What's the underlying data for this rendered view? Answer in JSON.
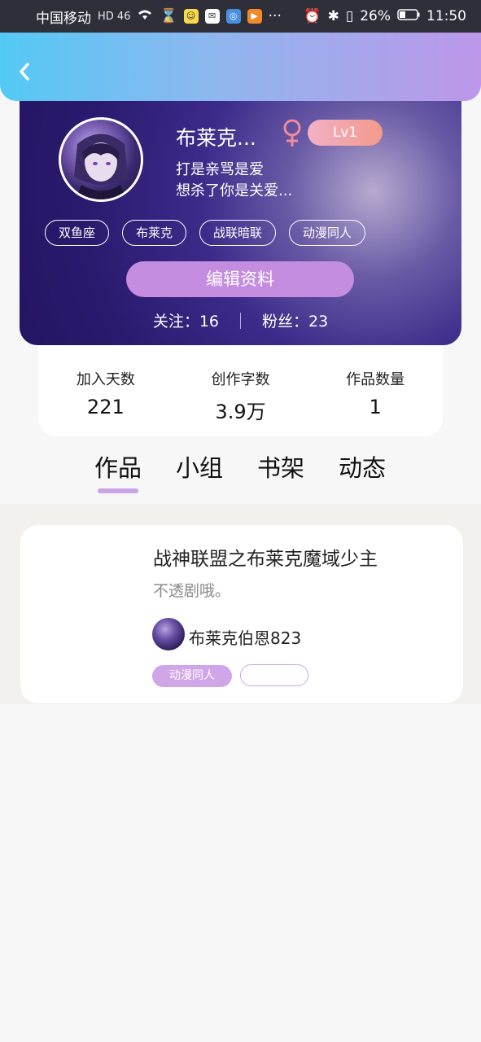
{
  "status_bar": {
    "carrier": "中国移动",
    "network": "HD 46",
    "battery": "26%",
    "time": "11:50",
    "more": "···"
  },
  "profile": {
    "username": "布莱克...",
    "gender_symbol": "♀",
    "level": "Lv1",
    "bio_line1": "打是亲骂是爱",
    "bio_line2": "想杀了你是关爱...",
    "tags": [
      "双鱼座",
      "布莱克",
      "战联暗联",
      "动漫同人"
    ],
    "edit_button": "编辑资料",
    "following": "关注：16",
    "followers": "粉丝：23"
  },
  "stats": [
    {
      "label": "加入天数",
      "value": "221"
    },
    {
      "label": "创作字数",
      "value": "3.9万"
    },
    {
      "label": "作品数量",
      "value": "1"
    }
  ],
  "tabs": [
    "作品",
    "小组",
    "书架",
    "动态"
  ],
  "work": {
    "title": "战神联盟之布莱克魔域少主",
    "description": "不透剧哦。",
    "author": "布莱克伯恩823",
    "tag": "动漫同人"
  },
  "colors": {
    "header_gradient_start": "#53c9f4",
    "header_gradient_end": "#bd97ea",
    "accent_purple": "#c48de0",
    "level_badge": "#f39a8c",
    "gender": "#f08a9c"
  }
}
